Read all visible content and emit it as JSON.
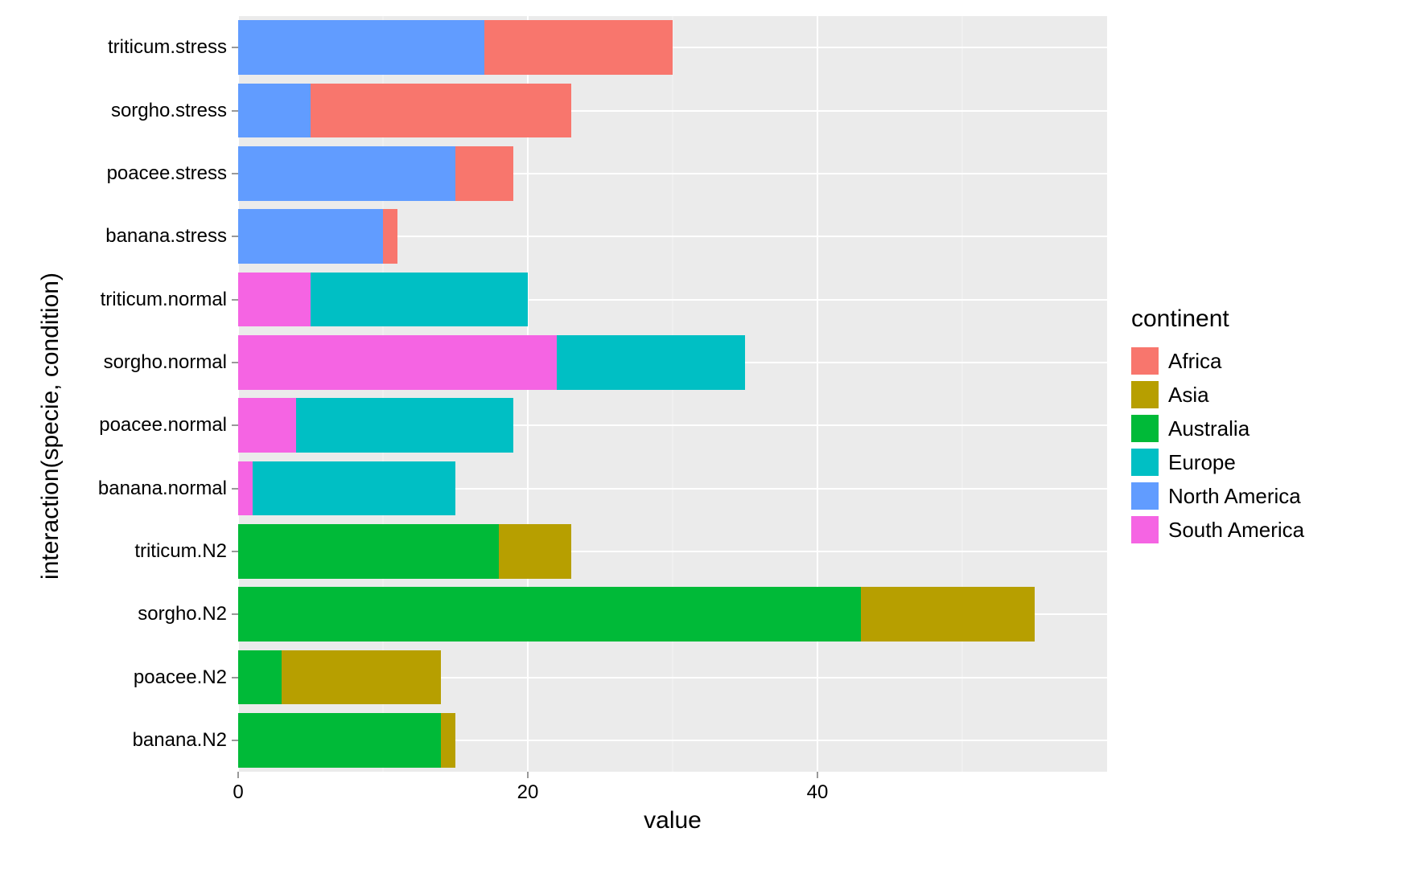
{
  "chart_data": {
    "type": "bar",
    "orientation": "horizontal",
    "stacked": true,
    "title": "",
    "xlabel": "value",
    "ylabel": "interaction(specie, condition)",
    "xlim": [
      0,
      60
    ],
    "x_ticks": [
      0,
      20,
      40
    ],
    "x_minor_ticks": [
      10,
      30,
      50
    ],
    "categories": [
      "triticum.stress",
      "sorgho.stress",
      "poacee.stress",
      "banana.stress",
      "triticum.normal",
      "sorgho.normal",
      "poacee.normal",
      "banana.normal",
      "triticum.N2",
      "sorgho.N2",
      "poacee.N2",
      "banana.N2"
    ],
    "legend_title": "continent",
    "series": [
      {
        "name": "Africa",
        "color": "#F8766D",
        "values": [
          13,
          18,
          4,
          1,
          0,
          0,
          0,
          0,
          0,
          0,
          0,
          0
        ]
      },
      {
        "name": "Asia",
        "color": "#B79F00",
        "values": [
          0,
          0,
          0,
          0,
          0,
          0,
          0,
          0,
          5,
          12,
          11,
          1
        ]
      },
      {
        "name": "Australia",
        "color": "#00BA38",
        "values": [
          0,
          0,
          0,
          0,
          0,
          0,
          0,
          0,
          18,
          43,
          3,
          14
        ]
      },
      {
        "name": "Europe",
        "color": "#00BFC4",
        "values": [
          0,
          0,
          0,
          0,
          15,
          13,
          15,
          14,
          0,
          0,
          0,
          0
        ]
      },
      {
        "name": "North America",
        "color": "#619CFF",
        "values": [
          17,
          5,
          15,
          10,
          0,
          0,
          0,
          0,
          0,
          0,
          0,
          0
        ]
      },
      {
        "name": "South America",
        "color": "#F564E3",
        "values": [
          0,
          0,
          0,
          0,
          5,
          22,
          4,
          1,
          0,
          0,
          0,
          0
        ]
      }
    ],
    "stack_order": [
      "North America",
      "Africa",
      "South America",
      "Europe",
      "Australia",
      "Asia"
    ]
  }
}
